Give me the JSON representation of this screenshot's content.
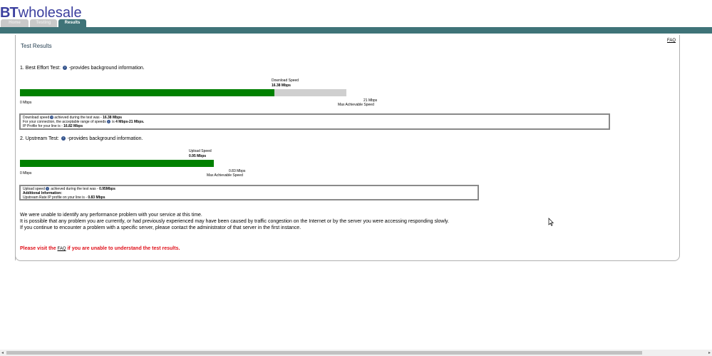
{
  "brand": {
    "bt": "BT",
    "wholesale": "wholesale",
    "color": "#3b3f9e"
  },
  "tabs": [
    {
      "label": "Home",
      "active": false
    },
    {
      "label": "Testing",
      "active": false
    },
    {
      "label": "Results",
      "active": true
    }
  ],
  "colors": {
    "topbar": "#3f7378",
    "bar_fill": "#008000",
    "bar_bg": "#cfcfcf",
    "warning": "#e0101a"
  },
  "faq_link": "FAQ",
  "page_title": "Test Results",
  "best_effort": {
    "heading_prefix": "1. Best Effort Test:",
    "heading_suffix": "-provides background information.",
    "download_label": "Download  Speed",
    "download_value": "16.38 Mbps",
    "progress_fraction": 0.78,
    "min_label": "0 Mbps",
    "max_value": "21 Mbps",
    "max_label": "Max Achievable Speed",
    "details": {
      "line1_prefix": "Download speed",
      "line1_middle": "achieved during the test was - ",
      "line1_value": "16.38 Mbps",
      "line2_prefix": "For your connection, the acceptable range of speeds",
      "line2_middle": " is ",
      "line2_value": "4 Mbps-21 Mbps.",
      "line3_prefix": "IP Profile for your line is - ",
      "line3_value": "16.82 Mbps"
    }
  },
  "upstream": {
    "heading_prefix": "2. Upstream Test:",
    "heading_suffix": "-provides background information.",
    "upload_label": "Upload Speed",
    "upload_value": "0.95 Mbps",
    "progress_fraction": 1.0,
    "min_label": "0 Mbps",
    "max_value": "0.83 Mbps",
    "max_label": "Max Achievable Speed",
    "details": {
      "line1_prefix": "Upload speed",
      "line1_middle": " achieved during the test was - ",
      "line1_value": "0.95Mbps",
      "line2": "Additional Information:",
      "line3_prefix": "Upstream Rate IP profile on your line is - ",
      "line3_value": "0.83 Mbps"
    }
  },
  "message": {
    "line1": "We were unable to identify any performance problem with your service at this time.",
    "line2": "It is possible that any problem you are currently, or had previously experienced may have been caused by traffic congestion on the Internet or by the server you were accessing responding slowly.",
    "line3": "If you continue to encounter a problem with a specific server, please contact the administrator of that server in the first instance."
  },
  "warning": {
    "prefix": "Please visit the ",
    "link": "FAQ",
    "suffix": " if you are unable to understand the test results."
  }
}
